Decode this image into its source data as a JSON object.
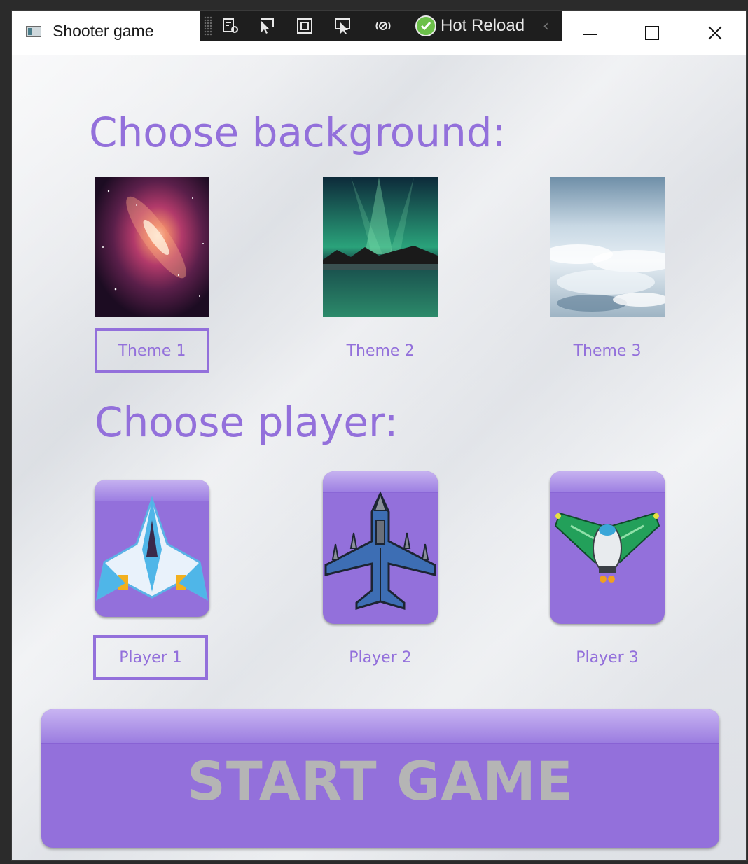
{
  "window": {
    "title": "Shooter game"
  },
  "debug_toolbar": {
    "hot_reload_label": "Hot Reload",
    "icons": [
      "live-visual-tree-icon",
      "select-element-icon",
      "display-layout-adorners-icon",
      "track-focused-element-icon",
      "binding-failures-icon",
      "hot-reload-status-icon"
    ]
  },
  "background_section": {
    "heading": "Choose background:",
    "options": [
      {
        "label": "Theme 1",
        "image": "galaxy",
        "selected": true
      },
      {
        "label": "Theme 2",
        "image": "aurora-lake",
        "selected": false
      },
      {
        "label": "Theme 3",
        "image": "clouds-above",
        "selected": false
      }
    ]
  },
  "player_section": {
    "heading": "Choose player:",
    "options": [
      {
        "label": "Player 1",
        "image": "white-blue-spaceship",
        "selected": true
      },
      {
        "label": "Player 2",
        "image": "blue-jet-fighter",
        "selected": false
      },
      {
        "label": "Player 3",
        "image": "green-winged-spaceship",
        "selected": false
      }
    ]
  },
  "start_button": {
    "label": "START GAME"
  },
  "colors": {
    "accent": "#9370db",
    "start_text": "#b5b5b5"
  }
}
